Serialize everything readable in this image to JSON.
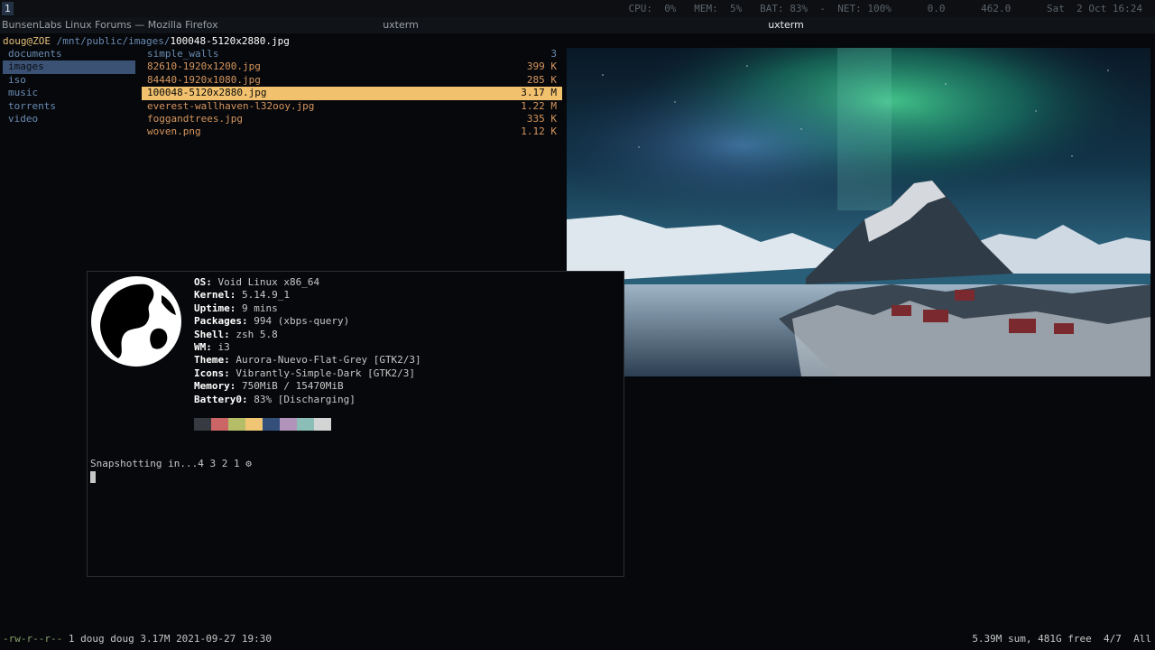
{
  "bar": {
    "workspace": "1",
    "status": "CPU:  0%   MEM:  5%   BAT: 83%  -  NET: 100%      0.0      462.0      Sat  2 Oct 16:24"
  },
  "windows": {
    "firefox_title": "BunsenLabs Linux Forums — Mozilla Firefox",
    "xterm_title_1": "uxterm",
    "xterm_title_2": "uxterm"
  },
  "ranger": {
    "user_host": "doug@ZOE",
    "path": " /mnt/public/images/",
    "current_file": "100048-5120x2880.jpg",
    "parent_dirs": [
      {
        "name": "documents"
      },
      {
        "name": "images"
      },
      {
        "name": "iso"
      },
      {
        "name": "music"
      },
      {
        "name": "torrents"
      },
      {
        "name": "video"
      }
    ],
    "files": [
      {
        "name": "simple_walls",
        "size": "3"
      },
      {
        "name": "82610-1920x1200.jpg",
        "size": "399 K"
      },
      {
        "name": "84440-1920x1080.jpg",
        "size": "285 K"
      },
      {
        "name": "100048-5120x2880.jpg",
        "size": "3.17 M"
      },
      {
        "name": "everest-wallhaven-l32ooy.jpg",
        "size": "1.22 M"
      },
      {
        "name": "foggandtrees.jpg",
        "size": "335 K"
      },
      {
        "name": "woven.png",
        "size": "1.12 K"
      }
    ],
    "status_perm": "-rw-r--r--",
    "status_info": " 1 doug doug 3.17M 2021-09-27 19:30",
    "status_right": "5.39M sum, 481G free  4/7  All"
  },
  "neofetch": {
    "rows": [
      {
        "key": "OS",
        "value": "Void Linux x86_64"
      },
      {
        "key": "Kernel",
        "value": "5.14.9_1"
      },
      {
        "key": "Uptime",
        "value": "9 mins"
      },
      {
        "key": "Packages",
        "value": "994 (xbps-query)"
      },
      {
        "key": "Shell",
        "value": "zsh 5.8"
      },
      {
        "key": "WM",
        "value": "i3"
      },
      {
        "key": "Theme",
        "value": "Aurora-Nuevo-Flat-Grey [GTK2/3]"
      },
      {
        "key": "Icons",
        "value": "Vibrantly-Simple-Dark [GTK2/3]"
      },
      {
        "key": "Memory",
        "value": "750MiB / 15470MiB"
      },
      {
        "key": "Battery0",
        "value": "83% [Discharging]"
      }
    ],
    "palette": [
      "#373b41",
      "#cc6666",
      "#b5bd68",
      "#f0c674",
      "#34507a",
      "#b294bb",
      "#8abeb7",
      "#d2d5d3"
    ],
    "snapshot_text": "Snapshotting in...4 3 2 1 ",
    "spinner_glyph": "⚙"
  },
  "colors": {
    "selected_file_bg": "#f1c16e",
    "selected_dir_bg": "#3b5275",
    "dir_color": "#6a8bb3",
    "file_color": "#d6955e"
  }
}
